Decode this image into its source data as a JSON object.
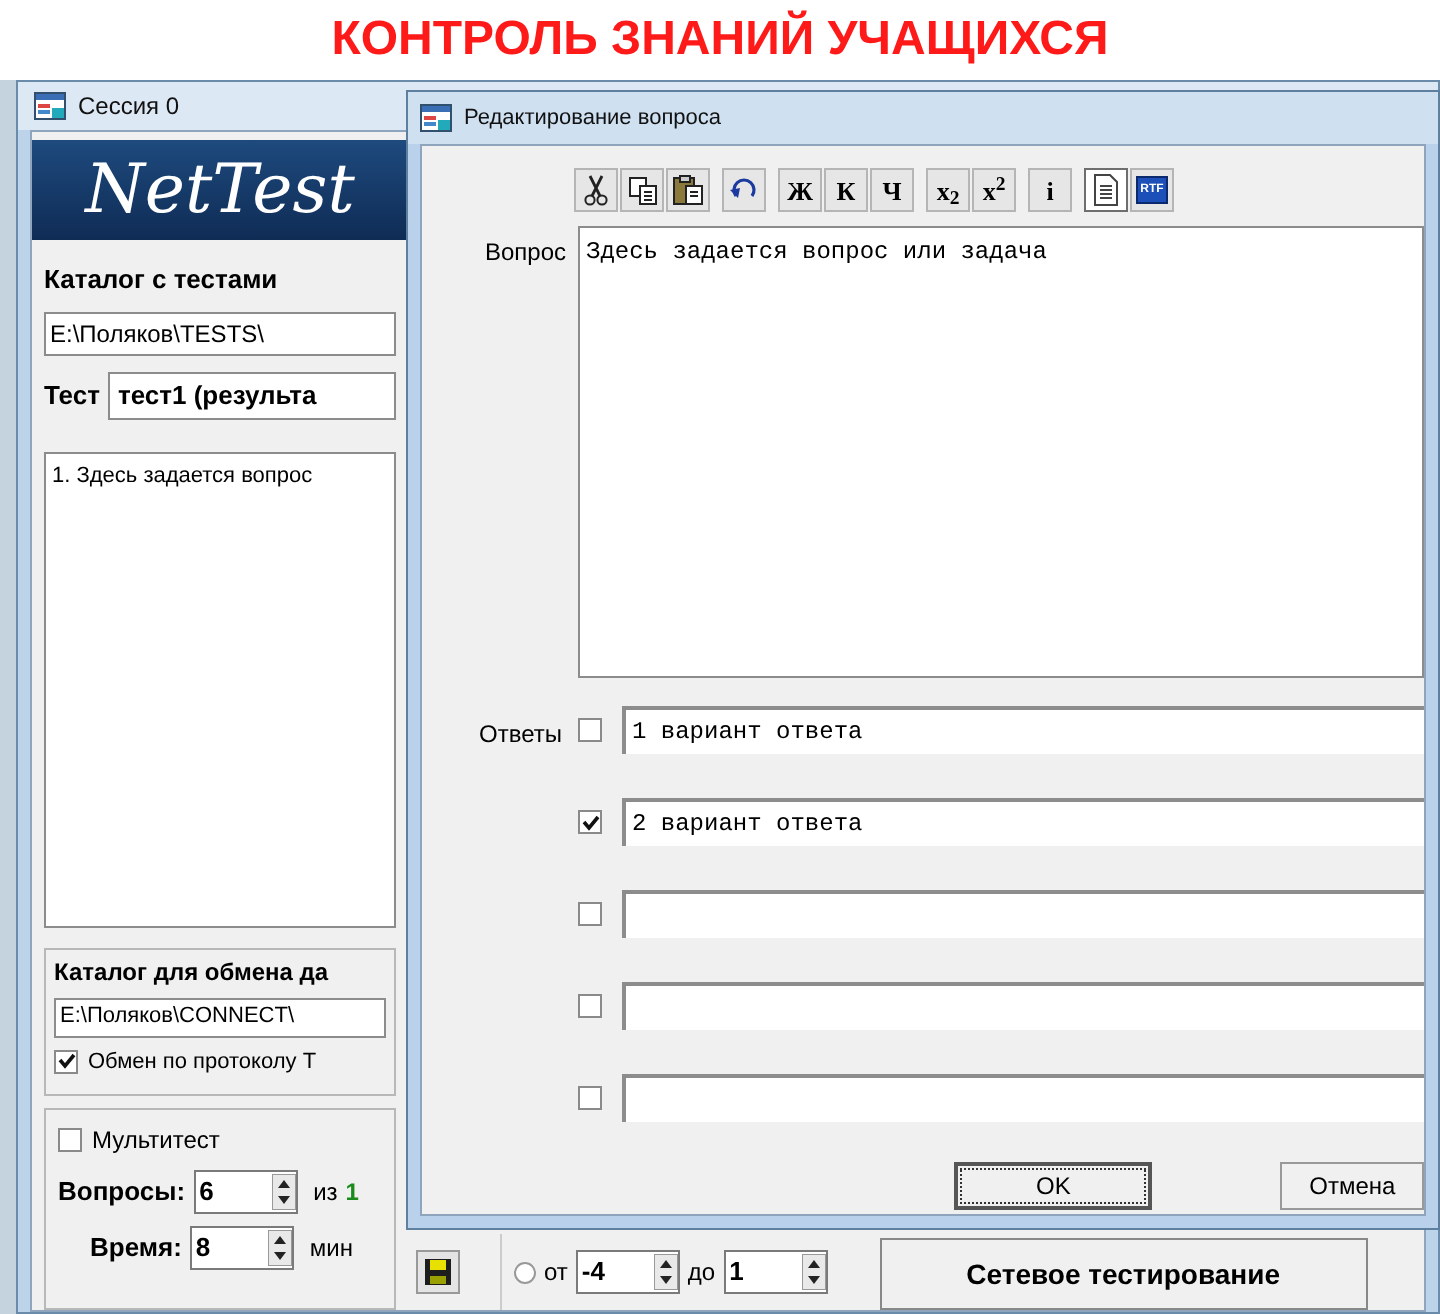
{
  "headline": "КОНТРОЛЬ ЗНАНИЙ УЧАЩИХСЯ",
  "main_window": {
    "title": "Сессия 0",
    "banner": "NetTest",
    "catalog_label": "Каталог с тестами",
    "catalog_path": "E:\\Поляков\\TESTS\\",
    "test_label": "Тест",
    "test_value": "тест1 (результа",
    "questions": [
      {
        "text": "1. Здесь задается вопрос"
      }
    ],
    "exchange": {
      "label": "Каталог для обмена да",
      "path": "E:\\Поляков\\CONNECT\\",
      "tcp": {
        "label": "Обмен по протоколу Т",
        "checked": true
      }
    },
    "multitest": {
      "label": "Мультитест",
      "checked": false
    },
    "question_count": {
      "label": "Вопросы:",
      "value": "6",
      "of_label": "из",
      "total": "1"
    },
    "time": {
      "label": "Время:",
      "value": "8",
      "unit": "мин"
    },
    "range": {
      "selected": false,
      "from_label": "от",
      "from": "-4",
      "to_label": "до",
      "to": "1"
    },
    "network_button": "Сетевое тестирование"
  },
  "dialog": {
    "title": "Редактирование вопроса",
    "toolbar": [
      {
        "buttons": [
          {
            "kind": "scissors",
            "pressed": false
          },
          {
            "kind": "copy",
            "pressed": false
          },
          {
            "kind": "paste",
            "pressed": false
          }
        ]
      },
      {
        "buttons": [
          {
            "kind": "undo",
            "pressed": false
          }
        ]
      },
      {
        "buttons": [
          {
            "kind": "text",
            "label": "Ж",
            "pressed": false
          },
          {
            "kind": "text",
            "label": "К",
            "pressed": false
          },
          {
            "kind": "text",
            "label": "Ч",
            "pressed": false
          }
        ]
      },
      {
        "buttons": [
          {
            "kind": "text",
            "label": "x$_{2}$",
            "pressed": false
          },
          {
            "kind": "text",
            "label": "x$^{2}$",
            "pressed": false
          }
        ]
      },
      {
        "buttons": [
          {
            "kind": "text",
            "label": "i",
            "pressed": false
          }
        ]
      },
      {
        "buttons": [
          {
            "kind": "page",
            "pressed": true
          },
          {
            "kind": "badge",
            "label": "RTF",
            "pressed": false
          }
        ]
      }
    ],
    "question_label": "Вопрос",
    "question": "Здесь задается вопрос или задача",
    "answers_label": "Ответы",
    "answers": [
      {
        "text": "1 вариант ответа",
        "checked": false
      },
      {
        "text": "2 вариант ответа",
        "checked": true
      },
      {
        "checked": false
      },
      {
        "checked": false
      },
      {
        "checked": false
      }
    ],
    "buttons": [
      {
        "label": "OK",
        "default": true
      },
      {
        "label": "Отмена",
        "default": false
      }
    ]
  }
}
